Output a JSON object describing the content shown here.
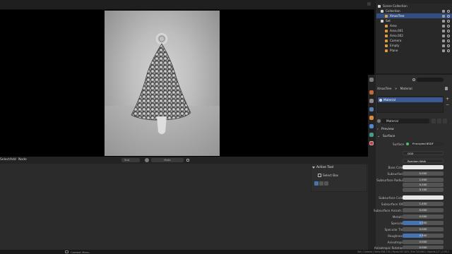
{
  "viewport": {
    "options_label": "Options"
  },
  "bottom_header": {
    "menu": [
      "Select",
      "Add",
      "Node"
    ],
    "slot_label": "Slot",
    "material_label": "Mate"
  },
  "active_tool": {
    "title": "Active Tool",
    "tool_label": "Select Box"
  },
  "outliner": {
    "rows": [
      {
        "label": "Scene Collection",
        "selected": false,
        "icon_color": "#d0d0d0"
      },
      {
        "label": "Collection",
        "selected": false,
        "icon_color": "#d0d0d0"
      },
      {
        "label": "XmasTree",
        "selected": true,
        "icon_color": "#e39a3b"
      },
      {
        "label": "Set",
        "selected": false,
        "icon_color": "#d0d0d0"
      },
      {
        "label": "Area",
        "selected": false,
        "icon_color": "#e39a3b"
      },
      {
        "label": "Area.001",
        "selected": false,
        "icon_color": "#e39a3b"
      },
      {
        "label": "Area.002",
        "selected": false,
        "icon_color": "#e39a3b"
      },
      {
        "label": "Camera",
        "selected": false,
        "icon_color": "#e39a3b"
      },
      {
        "label": "Empty",
        "selected": false,
        "icon_color": "#e39a3b"
      },
      {
        "label": "Plane",
        "selected": false,
        "icon_color": "#e39a3b"
      }
    ]
  },
  "properties": {
    "breadcrumb_object": "XmasTree",
    "breadcrumb_sep": ">",
    "breadcrumb_material": "Material",
    "slot_name": "Material",
    "material_name": "Material",
    "sections": {
      "preview": "Preview",
      "surface": "Surface"
    },
    "surface_label": "Surface",
    "surface_value": "Principled BSDF",
    "distribution": "GGX",
    "subsurface_method": "Random Walk",
    "fields": [
      {
        "label": "Base Color",
        "value": "",
        "kind": "white"
      },
      {
        "label": "Subsurface",
        "value": "0.000",
        "kind": "plain"
      },
      {
        "label": "Subsurface Radius",
        "value": "1.000",
        "kind": "plain"
      },
      {
        "label": "",
        "value": "0.200",
        "kind": "plain"
      },
      {
        "label": "",
        "value": "0.100",
        "kind": "plain"
      },
      {
        "label": "Subsurface Color",
        "value": "",
        "kind": "white"
      },
      {
        "label": "Subsurface IOR",
        "value": "1.400",
        "kind": "plain"
      },
      {
        "label": "Subsurface Anisotr...",
        "value": "0.000",
        "kind": "plain"
      },
      {
        "label": "Metallic",
        "value": "0.000",
        "kind": "plain"
      },
      {
        "label": "Specular",
        "value": "0.500",
        "kind": "blue"
      },
      {
        "label": "Specular Tint",
        "value": "0.000",
        "kind": "plain"
      },
      {
        "label": "Roughness",
        "value": "0.500",
        "kind": "blue"
      },
      {
        "label": "Anisotropic",
        "value": "0.000",
        "kind": "plain"
      },
      {
        "label": "Anisotropic Rotation",
        "value": "0.000",
        "kind": "plain"
      }
    ]
  },
  "status": {
    "left": "Context Menu",
    "right": "Set | Camera | Verts:358,716 | Faces:357,820 | Tris:715,640 | Objects:1/7 | 2.93.1"
  },
  "colors": {
    "accent": "#4772b3",
    "selection": "#334d80",
    "object_orange": "#e39a3b"
  }
}
